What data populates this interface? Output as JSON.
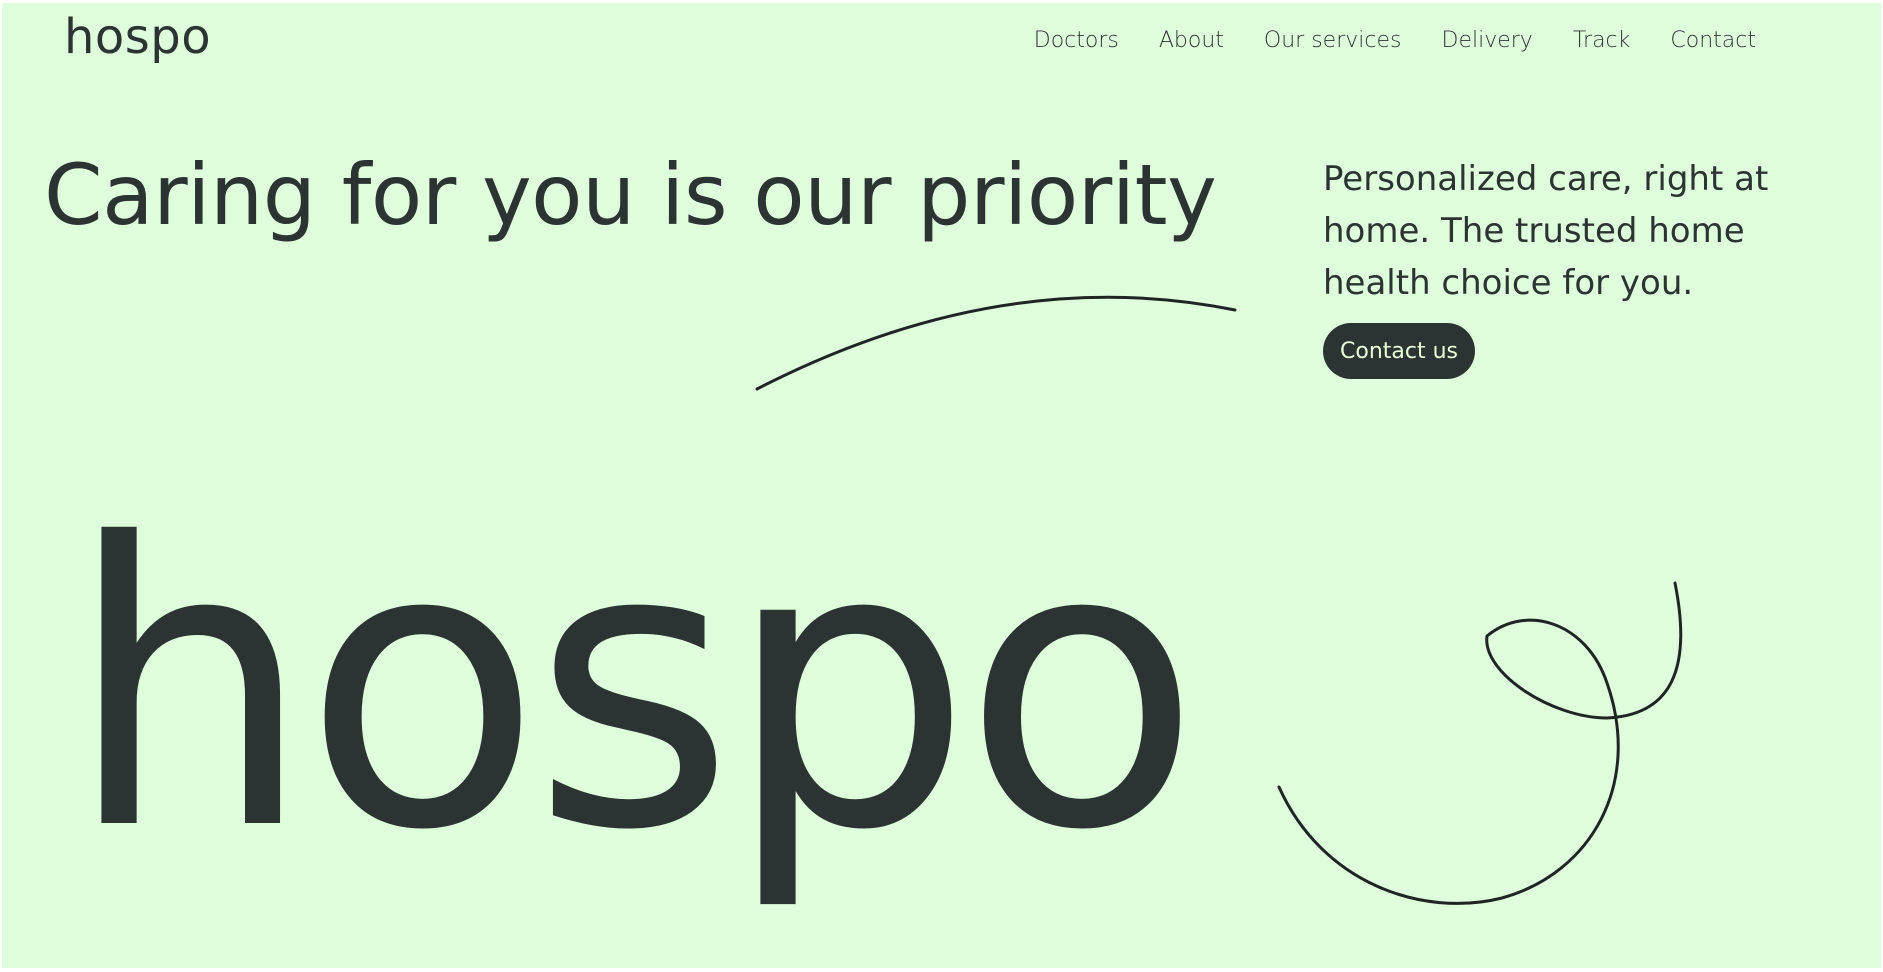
{
  "brand": {
    "name": "hospo",
    "wordmark": "hospo",
    "text_color": "#2c3433",
    "background_color": "#dfffdc",
    "cta_text_color": "#eaffd8"
  },
  "nav": {
    "items": [
      {
        "label": "Doctors"
      },
      {
        "label": "About"
      },
      {
        "label": "Our services"
      },
      {
        "label": "Delivery"
      },
      {
        "label": "Track"
      },
      {
        "label": "Contact"
      }
    ]
  },
  "hero": {
    "headline": "Caring for you is our priority",
    "tagline": "Personalized care, right at home. The trusted home health choice for you.",
    "cta_label": "Contact us"
  }
}
